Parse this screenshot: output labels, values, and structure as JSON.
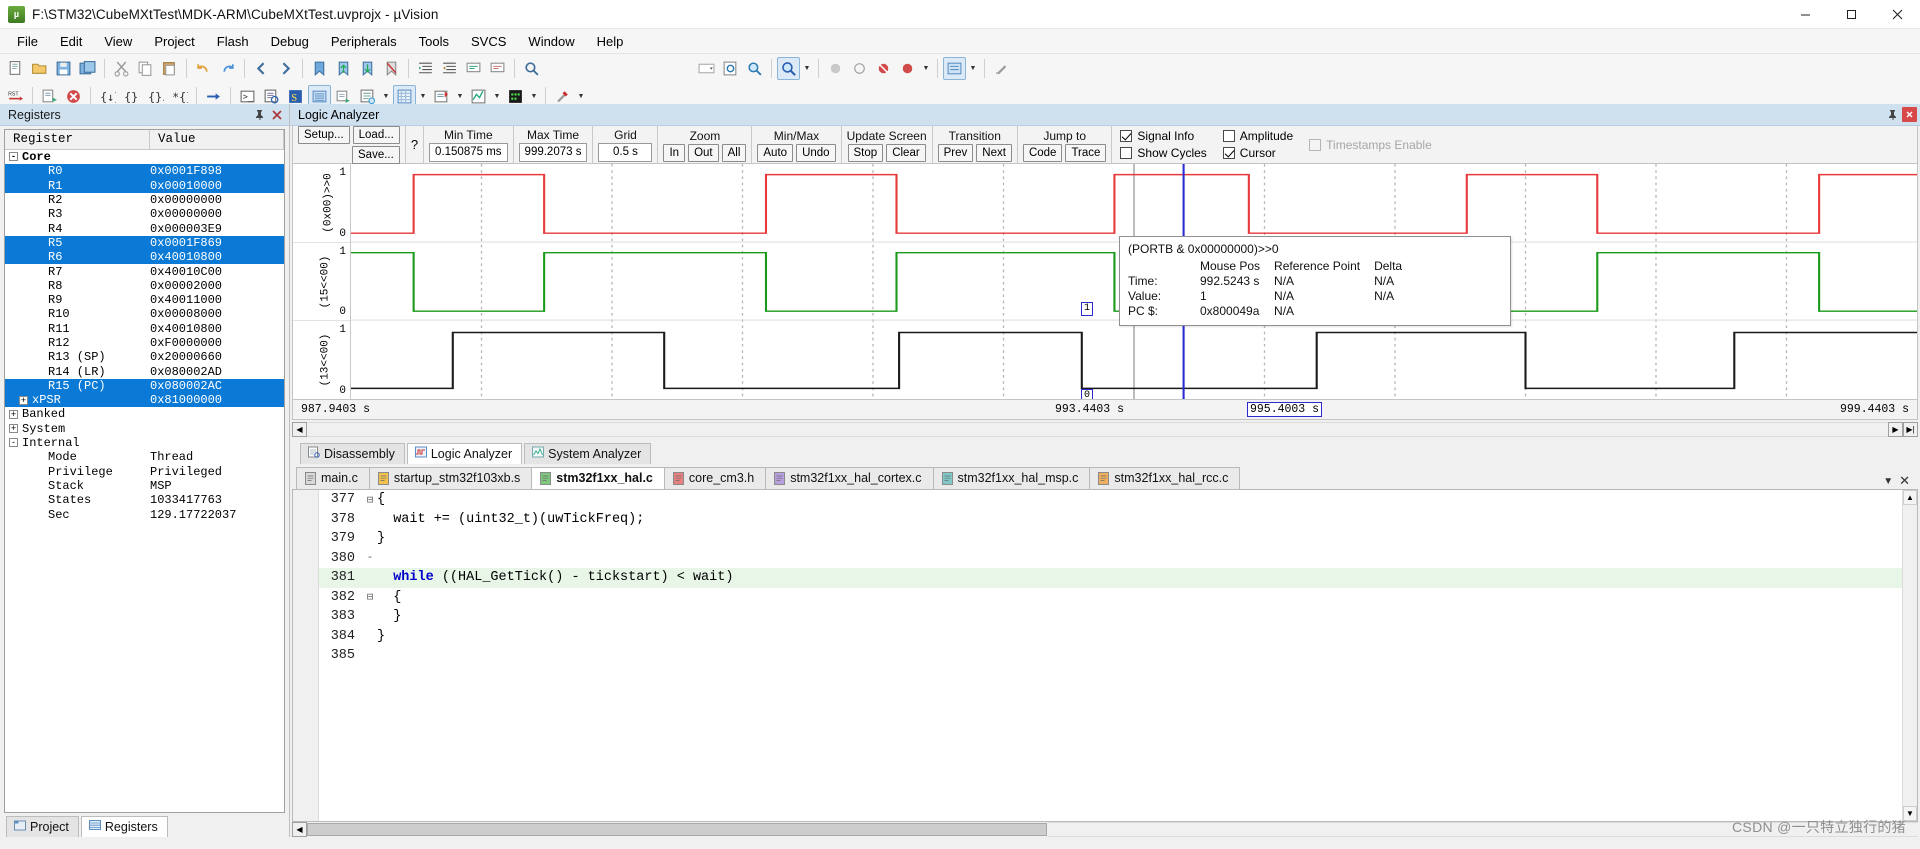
{
  "window": {
    "title": "F:\\STM32\\CubeMXtTest\\MDK-ARM\\CubeMXtTest.uvprojx - µVision",
    "icon": "uvision-logo-icon",
    "minimize": "–",
    "maximize": "☐",
    "close": "✕"
  },
  "menu": [
    {
      "label": "File"
    },
    {
      "label": "Edit"
    },
    {
      "label": "View"
    },
    {
      "label": "Project"
    },
    {
      "label": "Flash"
    },
    {
      "label": "Debug"
    },
    {
      "label": "Peripherals"
    },
    {
      "label": "Tools"
    },
    {
      "label": "SVCS"
    },
    {
      "label": "Window"
    },
    {
      "label": "Help"
    }
  ],
  "registers_pane": {
    "caption": "Registers",
    "pin_icon": "pin-icon",
    "close_icon": "close-icon",
    "columns": [
      "Register",
      "Value"
    ],
    "rows": [
      {
        "name": "Core",
        "value": "",
        "level": 0,
        "toggle": "-",
        "bold": true,
        "selected": false
      },
      {
        "name": "R0",
        "value": "0x0001F898",
        "level": 2,
        "toggle": "",
        "bold": false,
        "selected": true
      },
      {
        "name": "R1",
        "value": "0x00010000",
        "level": 2,
        "toggle": "",
        "bold": false,
        "selected": true
      },
      {
        "name": "R2",
        "value": "0x00000000",
        "level": 2,
        "toggle": "",
        "bold": false,
        "selected": false
      },
      {
        "name": "R3",
        "value": "0x00000000",
        "level": 2,
        "toggle": "",
        "bold": false,
        "selected": false
      },
      {
        "name": "R4",
        "value": "0x000003E9",
        "level": 2,
        "toggle": "",
        "bold": false,
        "selected": false
      },
      {
        "name": "R5",
        "value": "0x0001F869",
        "level": 2,
        "toggle": "",
        "bold": false,
        "selected": true
      },
      {
        "name": "R6",
        "value": "0x40010800",
        "level": 2,
        "toggle": "",
        "bold": false,
        "selected": true
      },
      {
        "name": "R7",
        "value": "0x40010C00",
        "level": 2,
        "toggle": "",
        "bold": false,
        "selected": false
      },
      {
        "name": "R8",
        "value": "0x00002000",
        "level": 2,
        "toggle": "",
        "bold": false,
        "selected": false
      },
      {
        "name": "R9",
        "value": "0x40011000",
        "level": 2,
        "toggle": "",
        "bold": false,
        "selected": false
      },
      {
        "name": "R10",
        "value": "0x00008000",
        "level": 2,
        "toggle": "",
        "bold": false,
        "selected": false
      },
      {
        "name": "R11",
        "value": "0x40010800",
        "level": 2,
        "toggle": "",
        "bold": false,
        "selected": false
      },
      {
        "name": "R12",
        "value": "0xF0000000",
        "level": 2,
        "toggle": "",
        "bold": false,
        "selected": false
      },
      {
        "name": "R13 (SP)",
        "value": "0x20000660",
        "level": 2,
        "toggle": "",
        "bold": false,
        "selected": false
      },
      {
        "name": "R14 (LR)",
        "value": "0x080002AD",
        "level": 2,
        "toggle": "",
        "bold": false,
        "selected": false
      },
      {
        "name": "R15 (PC)",
        "value": "0x080002AC",
        "level": 2,
        "toggle": "",
        "bold": false,
        "selected": true
      },
      {
        "name": "xPSR",
        "value": "0x81000000",
        "level": 1,
        "toggle": "+",
        "bold": false,
        "selected": true
      },
      {
        "name": "Banked",
        "value": "",
        "level": 0,
        "toggle": "+",
        "bold": false,
        "selected": false
      },
      {
        "name": "System",
        "value": "",
        "level": 0,
        "toggle": "+",
        "bold": false,
        "selected": false
      },
      {
        "name": "Internal",
        "value": "",
        "level": 0,
        "toggle": "-",
        "bold": false,
        "selected": false
      },
      {
        "name": "Mode",
        "value": "Thread",
        "level": 2,
        "toggle": "",
        "bold": false,
        "selected": false
      },
      {
        "name": "Privilege",
        "value": "Privileged",
        "level": 2,
        "toggle": "",
        "bold": false,
        "selected": false
      },
      {
        "name": "Stack",
        "value": "MSP",
        "level": 2,
        "toggle": "",
        "bold": false,
        "selected": false
      },
      {
        "name": "States",
        "value": "1033417763",
        "level": 2,
        "toggle": "",
        "bold": false,
        "selected": false
      },
      {
        "name": "Sec",
        "value": "129.17722037",
        "level": 2,
        "toggle": "",
        "bold": false,
        "selected": false
      }
    ],
    "bottom_tabs": [
      {
        "label": "Project",
        "icon": "project-icon",
        "active": false
      },
      {
        "label": "Registers",
        "icon": "registers-icon",
        "active": true
      }
    ]
  },
  "logic_analyzer": {
    "caption": "Logic Analyzer",
    "pin_icon": "pin-icon",
    "close_icon": "close-icon",
    "toolbar": {
      "setup_label": "Setup...",
      "load_label": "Load...",
      "save_label": "Save...",
      "help_label": "?",
      "min_time_label": "Min Time",
      "min_time_value": "0.150875 ms",
      "max_time_label": "Max Time",
      "max_time_value": "999.2073 s",
      "grid_label": "Grid",
      "grid_value": "0.5 s",
      "zoom_label": "Zoom",
      "zoom_in": "In",
      "zoom_out": "Out",
      "zoom_all": "All",
      "minmax_label": "Min/Max",
      "minmax_auto": "Auto",
      "minmax_undo": "Undo",
      "update_label": "Update Screen",
      "update_stop": "Stop",
      "update_clear": "Clear",
      "transition_label": "Transition",
      "transition_prev": "Prev",
      "transition_next": "Next",
      "jumpto_label": "Jump to",
      "jumpto_code": "Code",
      "jumpto_trace": "Trace",
      "chk_signal_info": {
        "label": "Signal Info",
        "checked": true,
        "disabled": false
      },
      "chk_show_cycles": {
        "label": "Show Cycles",
        "checked": false,
        "disabled": false
      },
      "chk_amplitude": {
        "label": "Amplitude",
        "checked": false,
        "disabled": false
      },
      "chk_cursor": {
        "label": "Cursor",
        "checked": true,
        "disabled": false
      },
      "chk_timestamps": {
        "label": "Timestamps Enable",
        "checked": false,
        "disabled": true
      }
    },
    "lanes": [
      {
        "name": "(0x00)>>0",
        "high": "1",
        "low": "0",
        "color": "#e03030"
      },
      {
        "name": "(15<<00)",
        "high": "1",
        "low": "0",
        "color": "#1a9a1a"
      },
      {
        "name": "(13<<00)",
        "high": "1",
        "low": "0",
        "color": "#1a1a1a"
      }
    ],
    "axis": {
      "left_label": "987.9403 s",
      "mid_label": "993.4403 s",
      "cursor_label": "995.4003 s",
      "right_label": "999.4403 s"
    },
    "tooltip": {
      "signal": "(PORTB & 0x00000000)>>0",
      "col_mouse": "Mouse Pos",
      "col_reference": "Reference Point",
      "col_delta": "Delta",
      "rows": [
        {
          "label": "Time:",
          "mouse": "992.5243 s",
          "reference": "N/A",
          "delta": "N/A"
        },
        {
          "label": "Value:",
          "mouse": "1",
          "reference": "N/A",
          "delta": "N/A"
        },
        {
          "label": "PC $:",
          "mouse": "0x800049a",
          "reference": "N/A",
          "delta": ""
        }
      ]
    },
    "cursor_markers": {
      "top": "1",
      "bottom": "0"
    }
  },
  "analyzer_tabs": [
    {
      "label": "Disassembly",
      "icon": "disassembly-icon",
      "active": false
    },
    {
      "label": "Logic Analyzer",
      "icon": "logic-analyzer-icon",
      "active": true
    },
    {
      "label": "System Analyzer",
      "icon": "system-analyzer-icon",
      "active": false
    }
  ],
  "editor": {
    "tabs": [
      {
        "label": "main.c",
        "active": false,
        "color": "#d8d8d8"
      },
      {
        "label": "startup_stm32f103xb.s",
        "active": false,
        "color": "#f2c14e"
      },
      {
        "label": "stm32f1xx_hal.c",
        "active": true,
        "color": "#7ec87e"
      },
      {
        "label": "core_cm3.h",
        "active": false,
        "color": "#e98080"
      },
      {
        "label": "stm32f1xx_hal_cortex.c",
        "active": false,
        "color": "#b79fe0"
      },
      {
        "label": "stm32f1xx_hal_msp.c",
        "active": false,
        "color": "#7ec8c8"
      },
      {
        "label": "stm32f1xx_hal_rcc.c",
        "active": false,
        "color": "#f0b060"
      }
    ],
    "dropdown_icon": "chevron-down-icon",
    "close_icon": "close-icon",
    "lines": [
      {
        "no": "377",
        "fold": "⊟",
        "text": "{",
        "marker": "breakpoint",
        "highlight": false
      },
      {
        "no": "378",
        "fold": "",
        "text": "  wait += (uint32_t)(uwTickFreq);",
        "marker": "breakpoint",
        "highlight": false
      },
      {
        "no": "379",
        "fold": "",
        "text": "}",
        "marker": "",
        "highlight": false
      },
      {
        "no": "380",
        "fold": "-",
        "text": "",
        "marker": "",
        "highlight": false
      },
      {
        "no": "381",
        "fold": "",
        "text": "  while ((HAL_GetTick() - tickstart) < wait)",
        "marker": "arrow",
        "highlight": true,
        "keyword": "while"
      },
      {
        "no": "382",
        "fold": "⊟",
        "text": "  {",
        "marker": "breakpoint",
        "highlight": false
      },
      {
        "no": "383",
        "fold": "",
        "text": "  }",
        "marker": "",
        "highlight": false
      },
      {
        "no": "384",
        "fold": "",
        "text": "}",
        "marker": "breakpoint",
        "highlight": false
      },
      {
        "no": "385",
        "fold": "",
        "text": "",
        "marker": "",
        "highlight": false
      }
    ]
  },
  "watermark": "CSDN @一只特立独行的猪",
  "colors": {
    "caption_bg": "#cfe0ef",
    "selection_blue": "#0a7ad6",
    "lane1": "#e03030",
    "lane2": "#1a9a1a",
    "lane3": "#1a1a1a",
    "cursor_blue": "#2a2ad0",
    "breakpoint_green": "#0d8a0d",
    "highlight_line": "#e7f6e7"
  }
}
